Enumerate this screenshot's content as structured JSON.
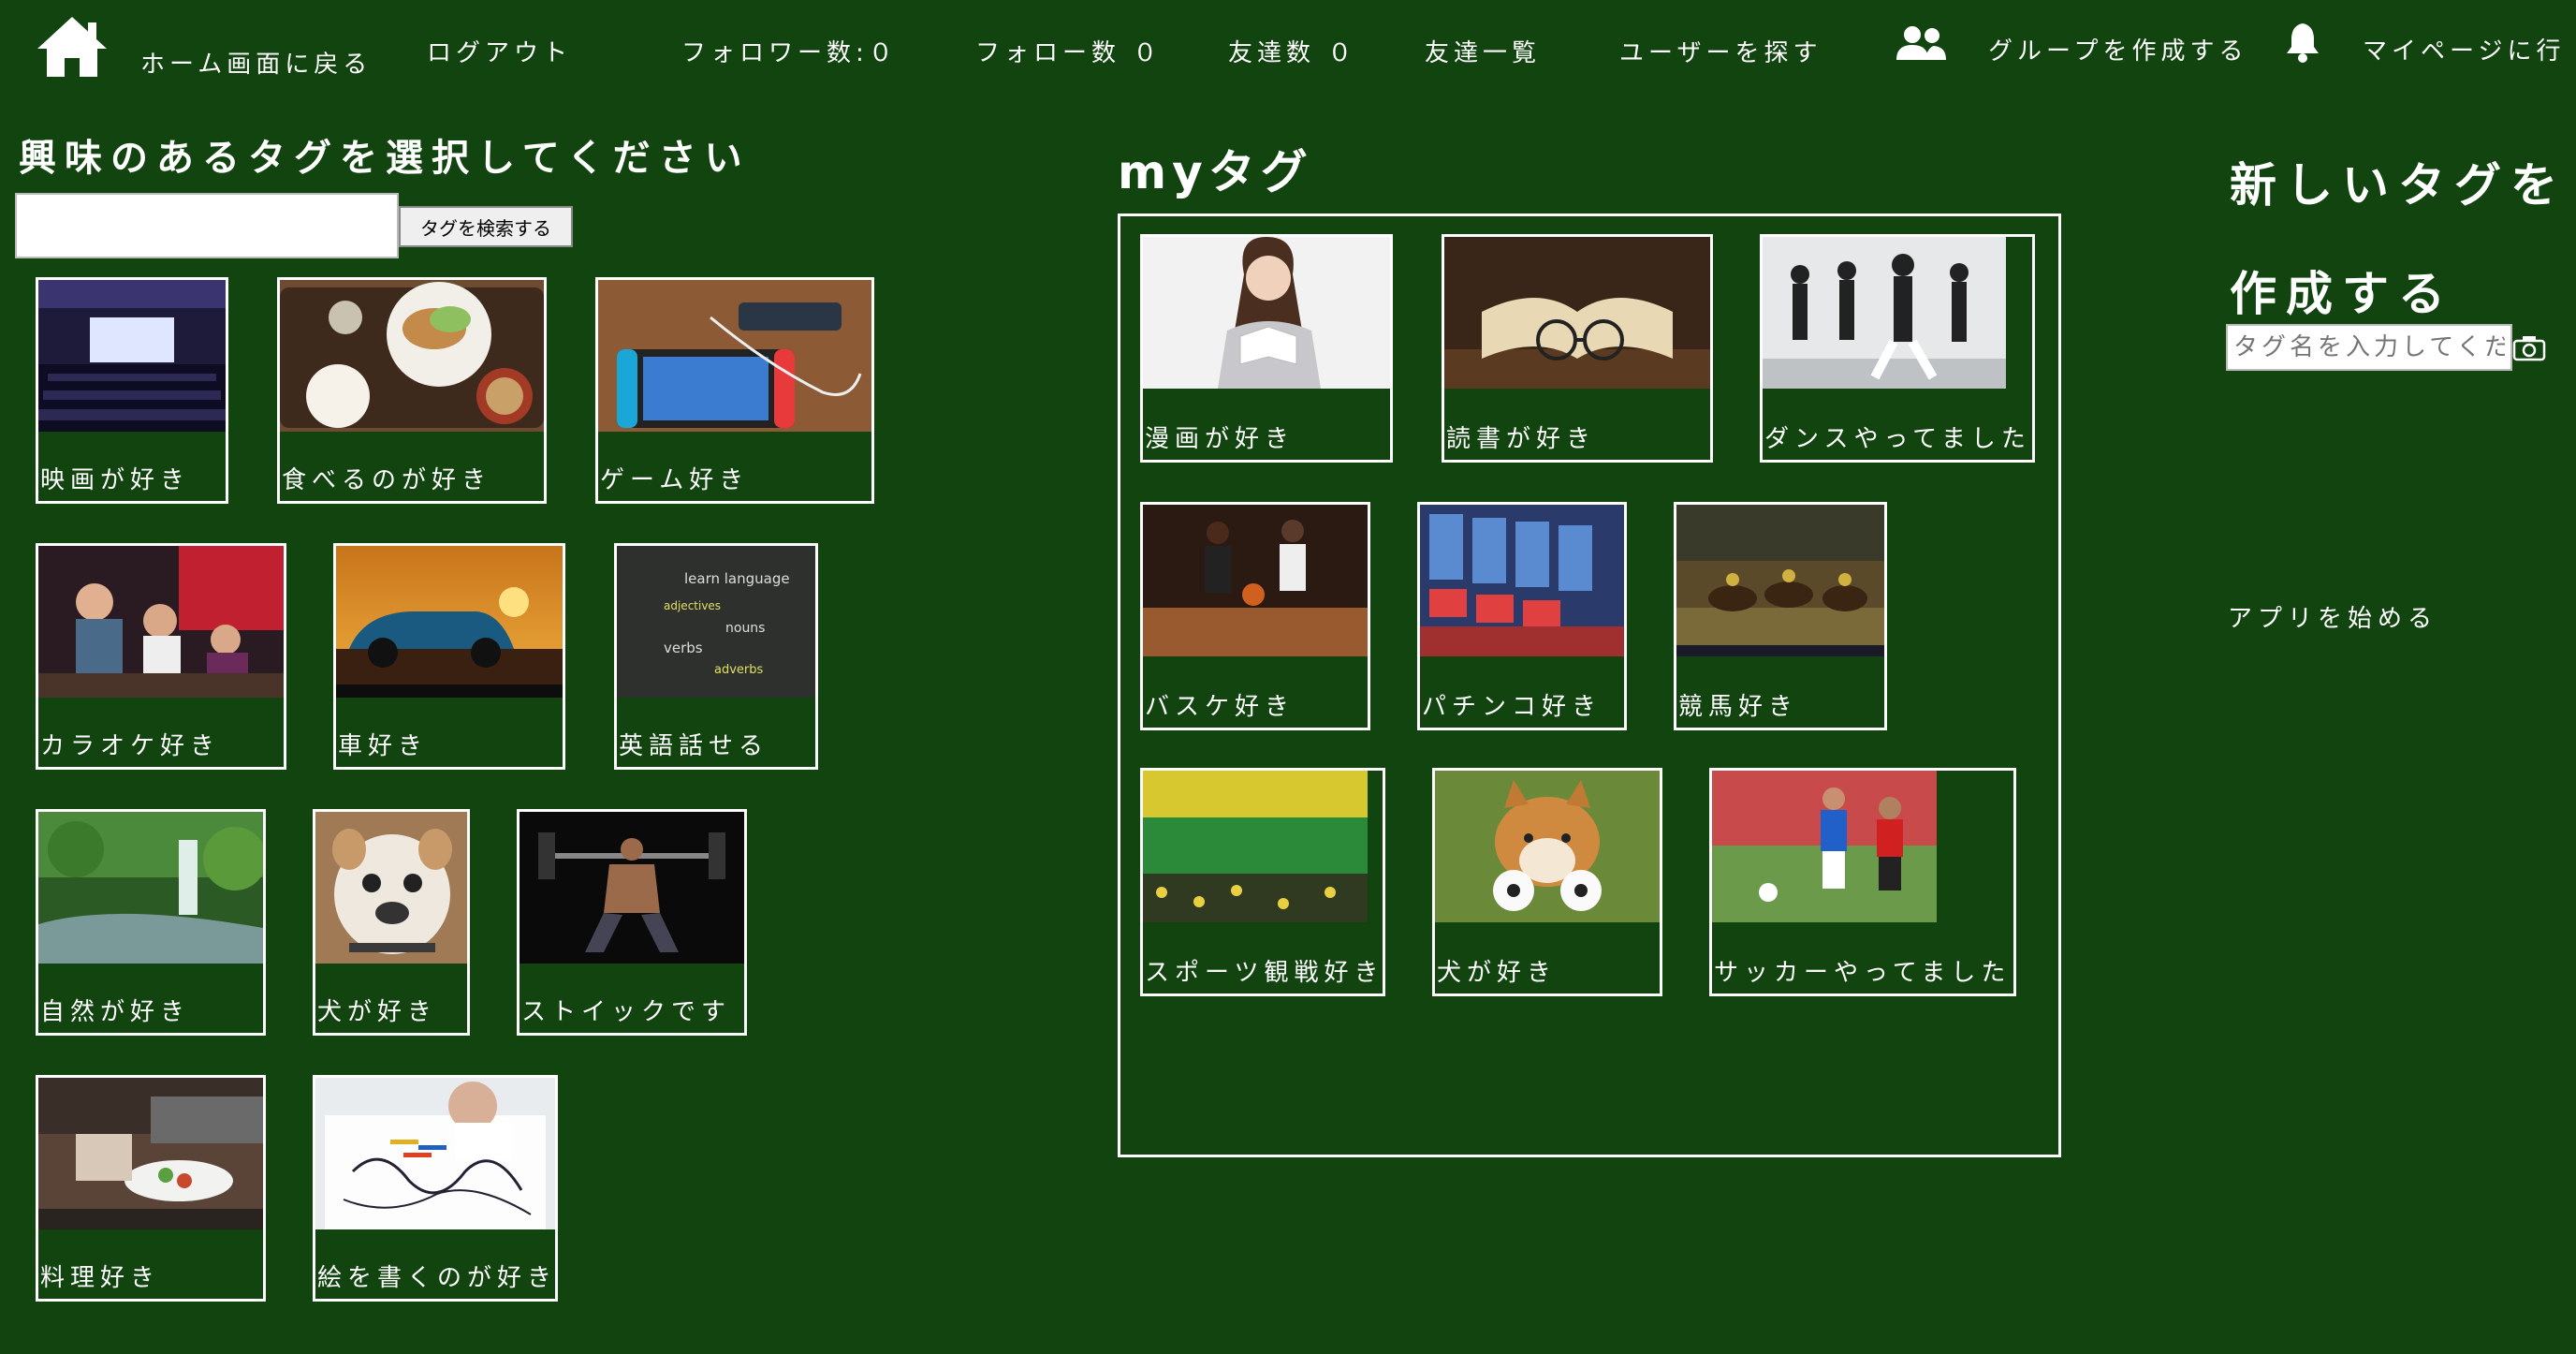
{
  "nav": {
    "home": "ホーム画面に戻る",
    "logout": "ログアウト",
    "followers": "フォロワー数:０",
    "following": "フォロー数 ０",
    "friends_count": "友達数 ０",
    "friends_list": "友達一覧",
    "find_users": "ユーザーを探す",
    "create_group": "グループを作成する",
    "mypage": "マイページに行"
  },
  "left": {
    "heading": "興味のあるタグを選択してください",
    "search_placeholder": "",
    "search_button": "タグを検索する",
    "tags": [
      {
        "label": "映画が好き",
        "image": "movie-theater"
      },
      {
        "label": "食べるのが好き",
        "image": "japanese-meal"
      },
      {
        "label": "ゲーム好き",
        "image": "nintendo-switch"
      },
      {
        "label": "カラオケ好き",
        "image": "karaoke-party"
      },
      {
        "label": "車好き",
        "image": "car-sunset"
      },
      {
        "label": "英語話せる",
        "image": "chalkboard-language"
      },
      {
        "label": "自然が好き",
        "image": "waterfall-forest"
      },
      {
        "label": "犬が好き",
        "image": "bulldog"
      },
      {
        "label": "ストイックです",
        "image": "weightlifter"
      },
      {
        "label": "料理好き",
        "image": "cooking"
      },
      {
        "label": "絵を書くのが好き",
        "image": "child-drawing"
      }
    ]
  },
  "mytags": {
    "heading": "myタグ",
    "tags": [
      {
        "label": "漫画が好き",
        "image": "reading-manga"
      },
      {
        "label": "読書が好き",
        "image": "book-glasses"
      },
      {
        "label": "ダンスやってました",
        "image": "dance-class"
      },
      {
        "label": "バスケ好き",
        "image": "basketball"
      },
      {
        "label": "パチンコ好き",
        "image": "pachinko"
      },
      {
        "label": "競馬好き",
        "image": "horse-racing"
      },
      {
        "label": "スポーツ観戦好き",
        "image": "stadium"
      },
      {
        "label": "犬が好き",
        "image": "shiba-puppy"
      },
      {
        "label": "サッカーやってました",
        "image": "soccer"
      }
    ]
  },
  "right": {
    "heading": "新しいタグを作成する",
    "tag_name_placeholder": "タグ名を入力してください",
    "start_app": "アプリを始める"
  },
  "chalkboard": {
    "line1": "learn language",
    "line2": "adjectives",
    "line3": "nouns",
    "line4": "verbs",
    "line5": "adverbs"
  },
  "colors": {
    "background": "#124410",
    "border": "#ffffff"
  }
}
